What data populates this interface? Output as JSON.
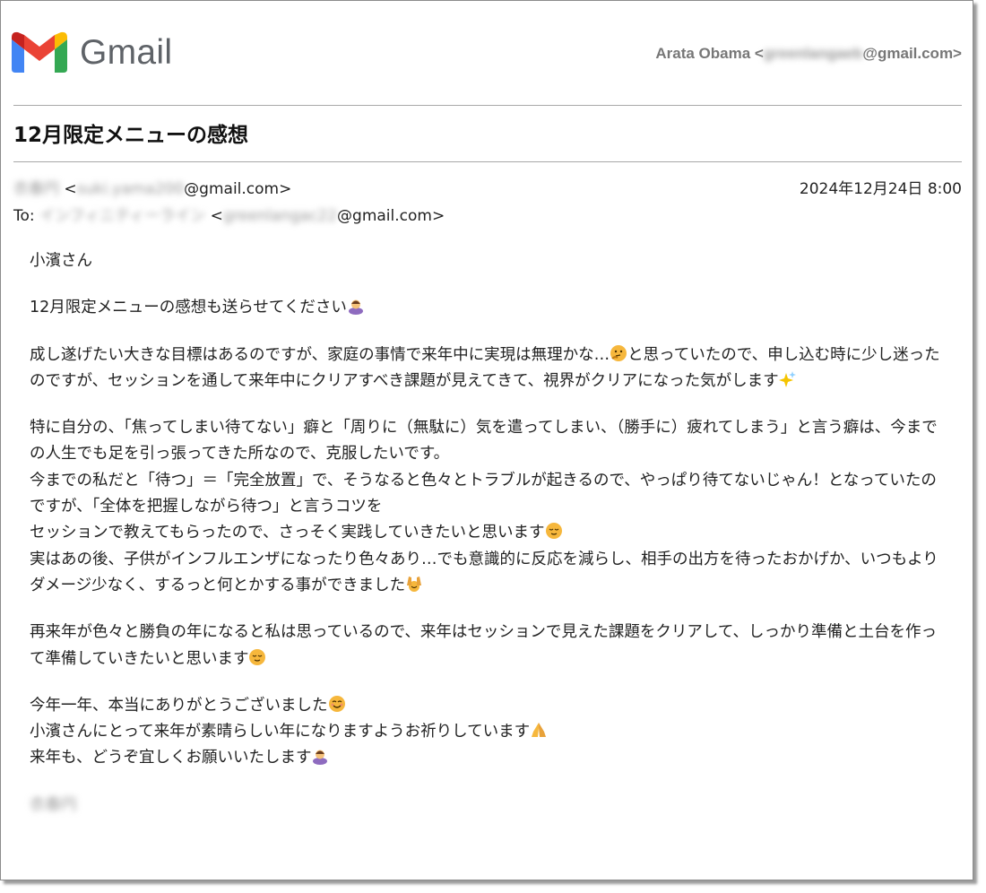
{
  "header": {
    "logo_text": "Gmail",
    "account_name": "Arata Obama",
    "account_email_prefix": "<",
    "account_email_local": "greenlangaeb",
    "account_email_domain": "@gmail.com>"
  },
  "email": {
    "subject": "12月限定メニューの感想",
    "from_name": "衣春円",
    "from_open": "<",
    "from_local": "suki.yama200",
    "from_domain": "@gmail.com>",
    "date": "2024年12月24日 8:00",
    "to_label": "To:",
    "to_name": "インフィニティーライン",
    "to_open": "<",
    "to_local": "greenlangac22",
    "to_domain": "@gmail.com>"
  },
  "body": {
    "greeting": "小濱さん",
    "p1": "12月限定メニューの感想も送らせてください",
    "p2a": "成し遂げたい大きな目標はあるのですが、家庭の事情で来年中に実現は無理かな…",
    "p2b": "と思っていたので、申し込む時に少し迷ったのですが、セッションを通して来年中にクリアすべき課題が見えてきて、視界がクリアになった気がします",
    "p3a": "特に自分の、「焦ってしまい待てない」癖と「周りに（無駄に）気を遣ってしまい、（勝手に）疲れてしまう」と言う癖は、今までの人生でも足を引っ張ってきた所なので、克服したいです。",
    "p3b": "今までの私だと「待つ」＝「完全放置」で、そうなると色々とトラブルが起きるので、やっぱり待てないじゃん！となっていたのですが、「全体を把握しながら待つ」と言うコツを",
    "p3c": "セッションで教えてもらったので、さっそく実践していきたいと思います",
    "p3d": "実はあの後、子供がインフルエンザになったり色々あり…でも意識的に反応を減らし、相手の出方を待ったおかげか、いつもよりダメージ少なく、するっと何とかする事ができました",
    "p4": "再来年が色々と勝負の年になると私は思っているので、来年はセッションで見えた課題をクリアして、しっかり準備と土台を作って準備していきたいと思います",
    "p5a": "今年一年、本当にありがとうございました",
    "p5b": "小濱さんにとって来年が素晴らしい年になりますようお祈りしています",
    "p5c": "来年も、どうぞ宜しくお願いいたします",
    "signature": "衣春円"
  },
  "icons": {
    "bow": "person-bowing-icon",
    "thinking": "thinking-face-icon",
    "sparkles": "sparkles-icon",
    "relieved": "relieved-face-icon",
    "raised_hands": "raising-hands-icon",
    "smile": "smiling-face-icon",
    "pray": "folded-hands-icon"
  },
  "colors": {
    "gmail_red": "#EA4335",
    "gmail_blue": "#4285F4",
    "gmail_green": "#34A853",
    "gmail_yellow": "#FBBC04",
    "gmail_dark_red": "#C5221F",
    "logo_text": "#5f6368"
  }
}
